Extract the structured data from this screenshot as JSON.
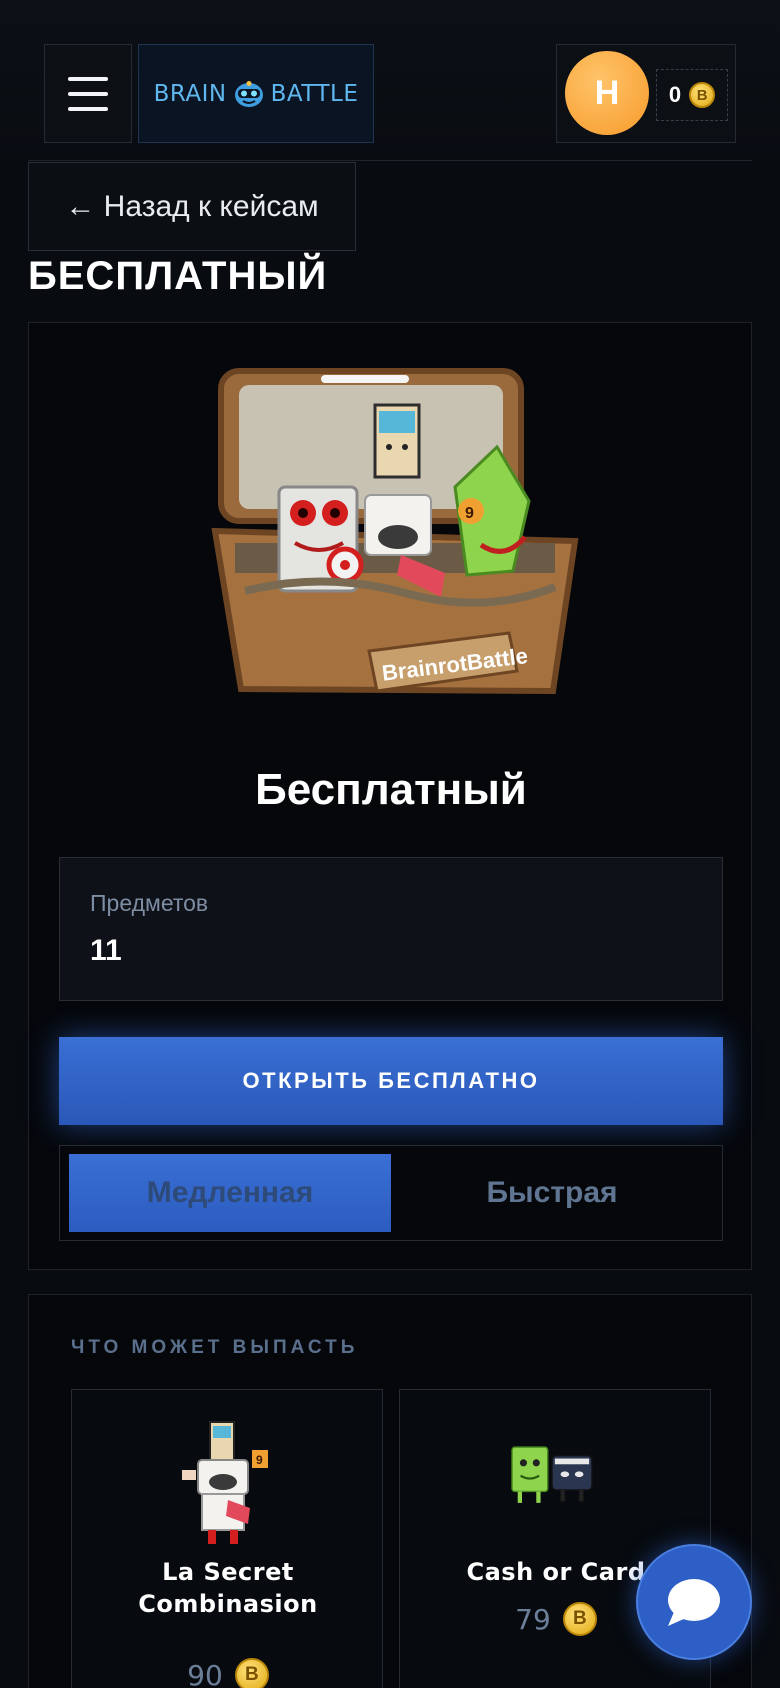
{
  "header": {
    "logo_left": "BRAIN",
    "logo_right": "BATTLE",
    "avatar_letter": "H",
    "balance": "0",
    "coin_symbol": "B"
  },
  "nav": {
    "back_label": "← Назад к кейсам"
  },
  "page": {
    "title": "БЕСПЛАТНЫЙ"
  },
  "case": {
    "name": "Бесплатный",
    "image_label": "BrainrotBattle",
    "items_label": "Предметов",
    "items_count": "11",
    "open_button": "ОТКРЫТЬ БЕСПЛАТНО",
    "speed_options": [
      "Медленная",
      "Быстрая"
    ],
    "selected_speed": "Медленная"
  },
  "drops": {
    "title": "ЧТО МОЖЕТ ВЫПАСТЬ",
    "items": [
      {
        "name": "La Secret Combinasion",
        "price": "90"
      },
      {
        "name": "Cash or Card",
        "price": "79"
      }
    ]
  },
  "colors": {
    "background": "#080b10",
    "accent": "#3a6fd4",
    "logo": "#5fb7ef",
    "avatar": "#f79a2a",
    "coin": "#e0a812"
  },
  "icons": [
    "menu-icon",
    "mascot-icon",
    "coin-icon",
    "chat-icon"
  ]
}
